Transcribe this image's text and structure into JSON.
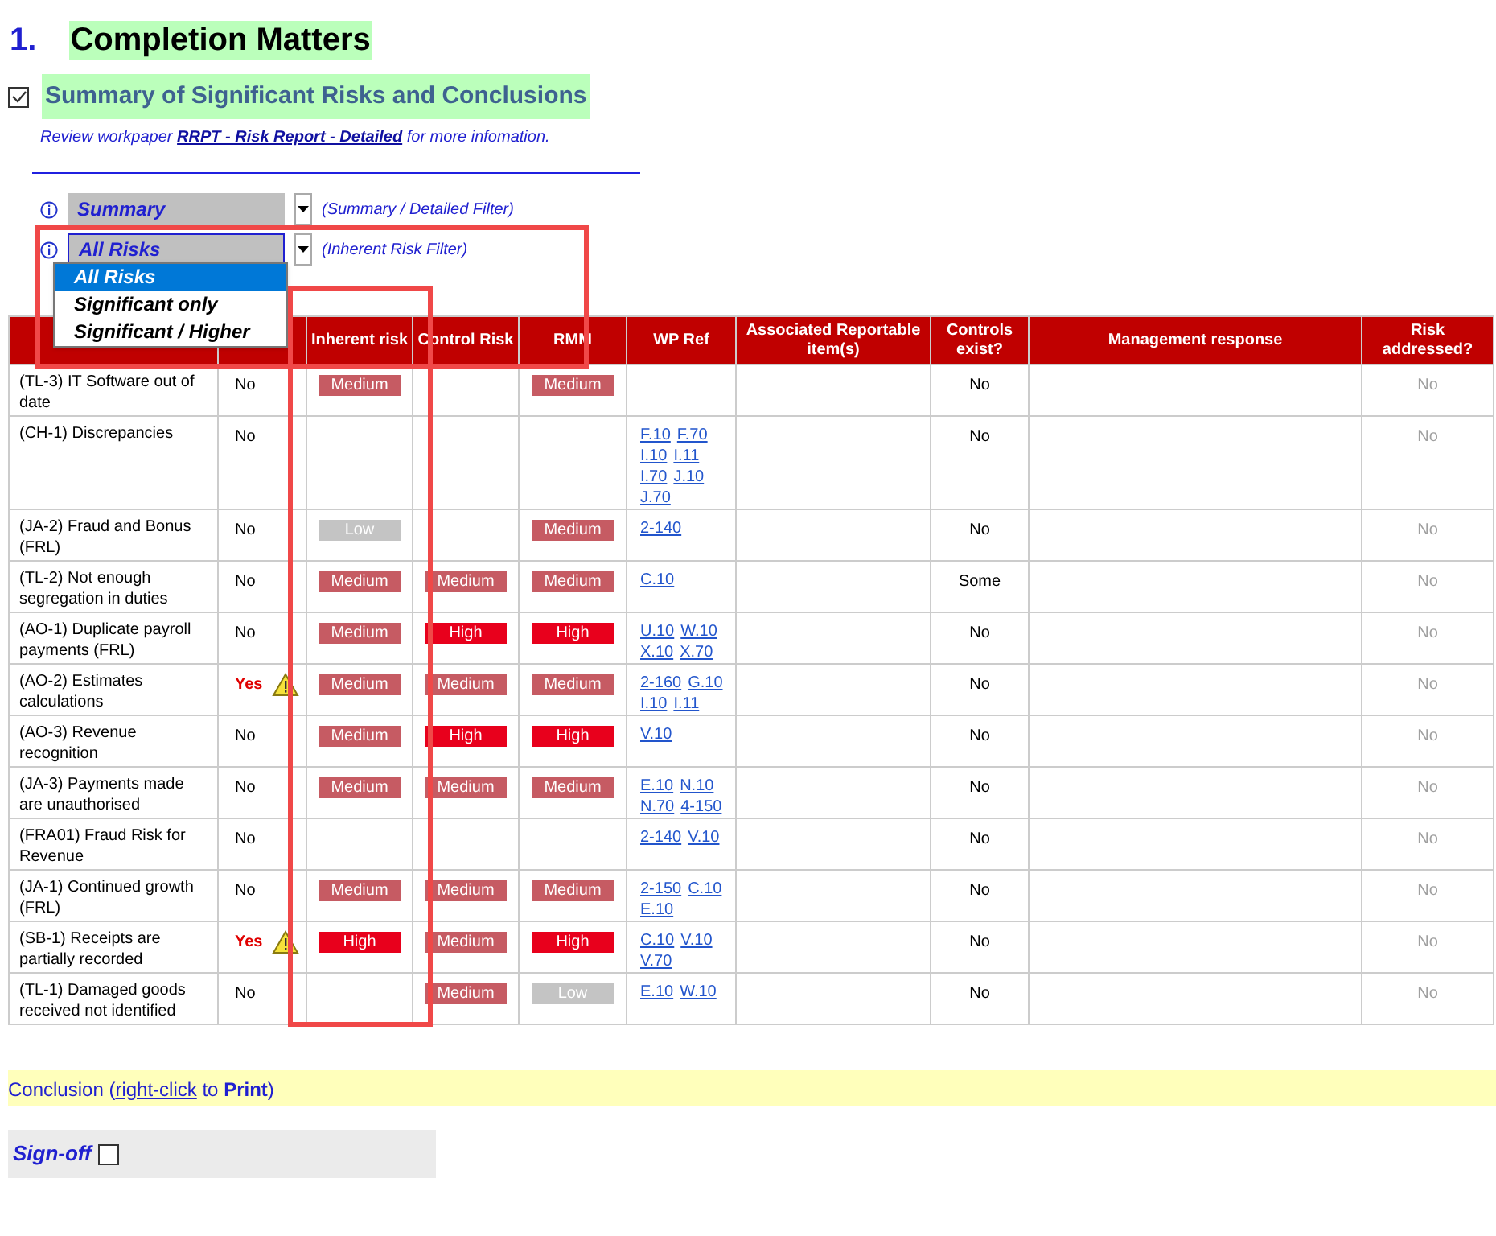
{
  "section": {
    "number": "1.",
    "title": "Completion Matters"
  },
  "summary": {
    "checked": true,
    "title": "Summary of Significant Risks and Conclusions"
  },
  "review_note": {
    "before": "Review workpaper",
    "link": "RRPT - Risk Report - Detailed",
    "after": "for more infomation."
  },
  "filters": [
    {
      "value": "Summary",
      "hint": "(Summary / Detailed Filter)",
      "open": false
    },
    {
      "value": "All Risks",
      "hint": "(Inherent Risk Filter)",
      "open": true,
      "options": [
        {
          "label": "All Risks",
          "selected": true
        },
        {
          "label": "Significant only",
          "selected": false
        },
        {
          "label": "Significant / Higher",
          "selected": false
        }
      ]
    }
  ],
  "table": {
    "columns": [
      "Inherent risk",
      "Control Risk",
      "RMM",
      "WP Ref",
      "Associated Reportable item(s)",
      "Controls exist?",
      "Management response",
      "Risk addressed?"
    ],
    "rows": [
      {
        "risk": "(TL-3) IT Software out of date",
        "significant": "No",
        "warning": false,
        "inherent": {
          "text": "Medium",
          "color": "#c65b63"
        },
        "rmm": {
          "text": "Medium",
          "color": "#c65b63"
        },
        "controls_exist": "No",
        "risk_addressed": "No"
      },
      {
        "risk": "(CH-1) Discrepancies",
        "significant": "No",
        "warning": false,
        "wp_refs": [
          "F.10",
          "F.70",
          "I.10",
          "I.11",
          "I.70",
          "J.10",
          "J.70"
        ],
        "controls_exist": "No",
        "risk_addressed": "No"
      },
      {
        "risk": "(JA-2) Fraud and Bonus (FRL)",
        "significant": "No",
        "warning": false,
        "inherent": {
          "text": "Low",
          "color": "#c4c4c4"
        },
        "rmm": {
          "text": "Medium",
          "color": "#c65b63"
        },
        "wp_refs": [
          "2-140"
        ],
        "controls_exist": "No",
        "risk_addressed": "No"
      },
      {
        "risk": "(TL-2) Not enough segregation in duties",
        "significant": "No",
        "warning": false,
        "inherent": {
          "text": "Medium",
          "color": "#c65b63"
        },
        "control": {
          "text": "Medium",
          "color": "#c65b63"
        },
        "rmm": {
          "text": "Medium",
          "color": "#c65b63"
        },
        "wp_refs": [
          "C.10"
        ],
        "controls_exist": "Some",
        "risk_addressed": "No"
      },
      {
        "risk": "(AO-1) Duplicate payroll payments (FRL)",
        "significant": "No",
        "warning": false,
        "inherent": {
          "text": "Medium",
          "color": "#c65b63"
        },
        "control": {
          "text": "High",
          "color": "#e8001c"
        },
        "rmm": {
          "text": "High",
          "color": "#e8001c"
        },
        "wp_refs": [
          "U.10",
          "W.10",
          "X.10",
          "X.70"
        ],
        "controls_exist": "No",
        "risk_addressed": "No"
      },
      {
        "risk": "(AO-2) Estimates calculations",
        "significant": "Yes",
        "warning": true,
        "inherent": {
          "text": "Medium",
          "color": "#c65b63"
        },
        "control": {
          "text": "Medium",
          "color": "#c65b63"
        },
        "rmm": {
          "text": "Medium",
          "color": "#c65b63"
        },
        "wp_refs": [
          "2-160",
          "G.10",
          "I.10",
          "I.11"
        ],
        "controls_exist": "No",
        "risk_addressed": "No"
      },
      {
        "risk": "(AO-3) Revenue recognition",
        "significant": "No",
        "warning": false,
        "inherent": {
          "text": "Medium",
          "color": "#c65b63"
        },
        "control": {
          "text": "High",
          "color": "#e8001c"
        },
        "rmm": {
          "text": "High",
          "color": "#e8001c"
        },
        "wp_refs": [
          "V.10"
        ],
        "controls_exist": "No",
        "risk_addressed": "No"
      },
      {
        "risk": "(JA-3) Payments made are unauthorised",
        "significant": "No",
        "warning": false,
        "inherent": {
          "text": "Medium",
          "color": "#c65b63"
        },
        "control": {
          "text": "Medium",
          "color": "#c65b63"
        },
        "rmm": {
          "text": "Medium",
          "color": "#c65b63"
        },
        "wp_refs": [
          "E.10",
          "N.10",
          "N.70",
          "4-150"
        ],
        "controls_exist": "No",
        "risk_addressed": "No"
      },
      {
        "risk": "(FRA01) Fraud Risk for Revenue",
        "significant": "No",
        "warning": false,
        "wp_refs": [
          "2-140",
          "V.10"
        ],
        "controls_exist": "No",
        "risk_addressed": "No"
      },
      {
        "risk": "(JA-1) Continued growth (FRL)",
        "significant": "No",
        "warning": false,
        "inherent": {
          "text": "Medium",
          "color": "#c65b63"
        },
        "control": {
          "text": "Medium",
          "color": "#c65b63"
        },
        "rmm": {
          "text": "Medium",
          "color": "#c65b63"
        },
        "wp_refs": [
          "2-150",
          "C.10",
          "E.10"
        ],
        "controls_exist": "No",
        "risk_addressed": "No"
      },
      {
        "risk": "(SB-1) Receipts are partially recorded",
        "significant": "Yes",
        "warning": true,
        "inherent": {
          "text": "High",
          "color": "#e8001c"
        },
        "control": {
          "text": "Medium",
          "color": "#c65b63"
        },
        "rmm": {
          "text": "High",
          "color": "#e8001c"
        },
        "wp_refs": [
          "C.10",
          "V.10",
          "V.70"
        ],
        "controls_exist": "No",
        "risk_addressed": "No"
      },
      {
        "risk": "(TL-1) Damaged goods received not identified",
        "significant": "No",
        "warning": false,
        "control": {
          "text": "Medium",
          "color": "#c65b63"
        },
        "rmm": {
          "text": "Low",
          "color": "#c4c4c4"
        },
        "wp_refs": [
          "E.10",
          "W.10"
        ],
        "controls_exist": "No",
        "risk_addressed": "No"
      }
    ]
  },
  "conclusion": {
    "prefix": "Conclusion (",
    "link": "right-click",
    "suffix": "to **Print**)"
  },
  "signoff": {
    "label": "Sign-off",
    "checked": false
  }
}
